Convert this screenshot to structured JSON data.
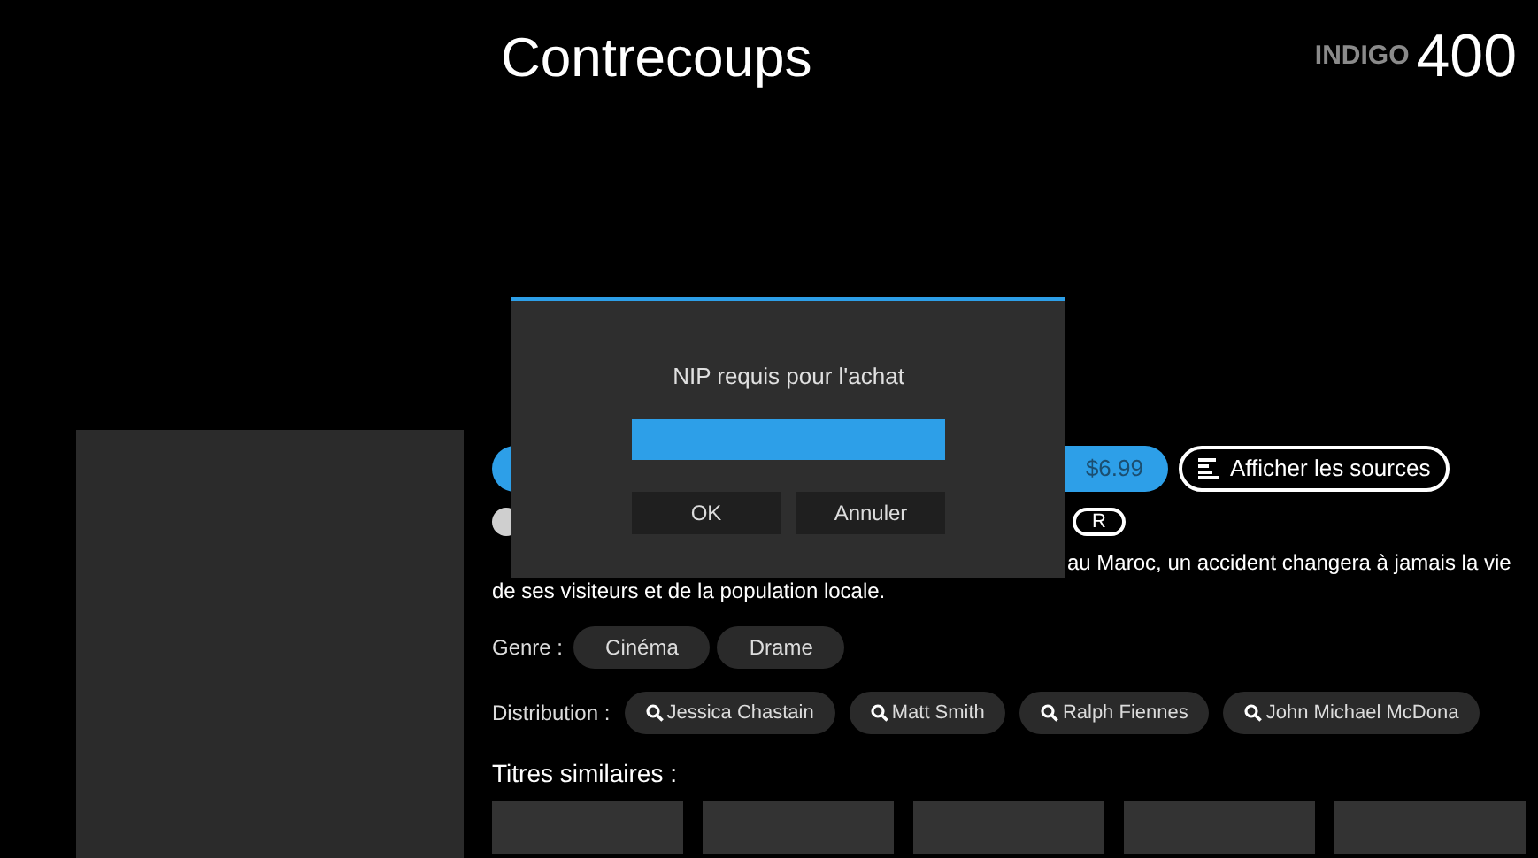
{
  "header": {
    "title": "Contrecoups",
    "logo_text": "INDIGO",
    "points": "400"
  },
  "actions": {
    "buy_label": "$6.99",
    "sources_label": "Afficher les sources"
  },
  "ratings": [
    {
      "text": "R"
    }
  ],
  "synopsis": {
    "line_1_visible_end": "au Maroc, un accident changera à jamais la vie",
    "line_2": "de ses visiteurs et de la population locale."
  },
  "genre": {
    "label": "Genre :",
    "items": [
      "Cinéma",
      "Drame"
    ]
  },
  "cast": {
    "label": "Distribution :",
    "items": [
      "Jessica Chastain",
      "Matt Smith",
      "Ralph Fiennes",
      "John Michael McDona"
    ]
  },
  "similar": {
    "label": "Titres similaires :"
  },
  "dialog": {
    "title": "NIP requis pour l'achat",
    "buttons": [
      "OK",
      "Annuler"
    ]
  }
}
